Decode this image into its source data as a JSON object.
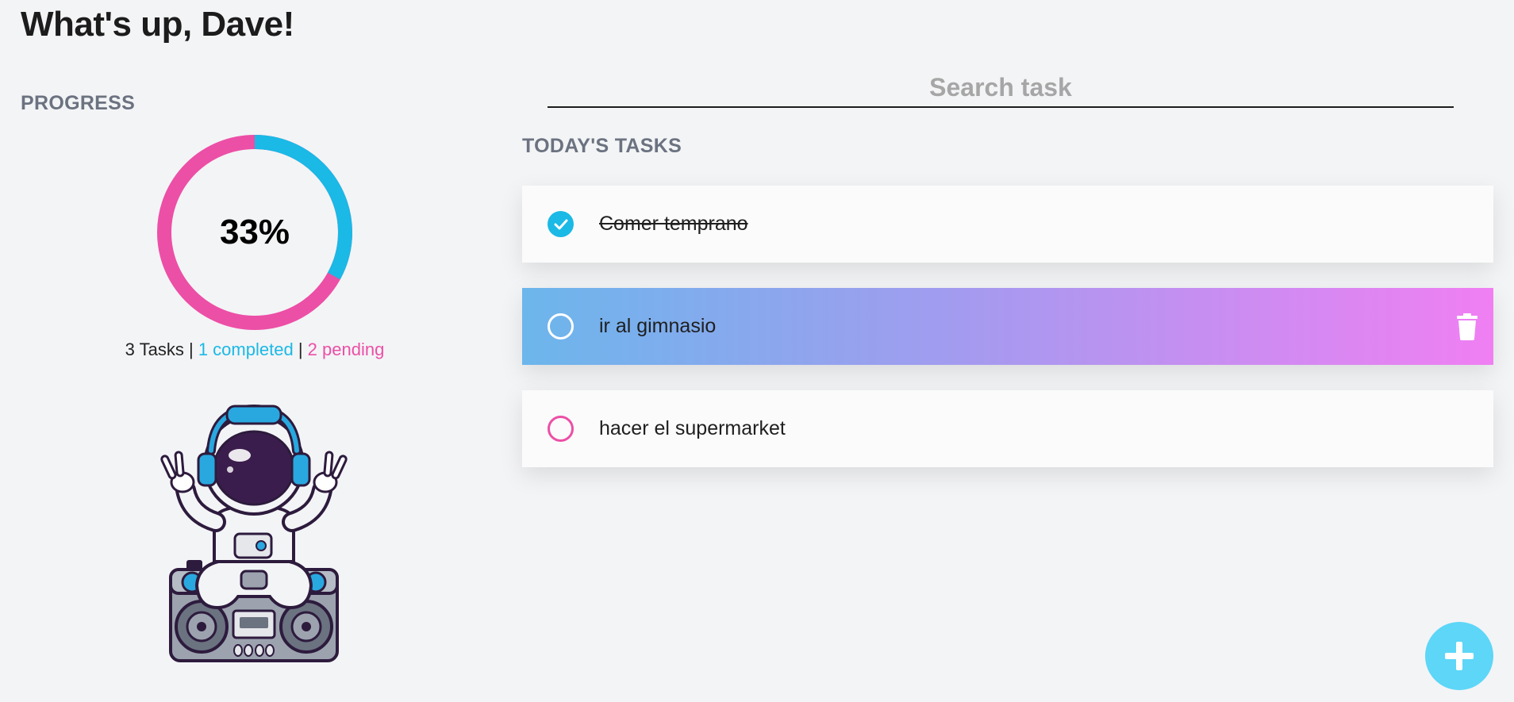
{
  "header": {
    "greeting": "What's up, Dave!"
  },
  "progress": {
    "title": "PROGRESS",
    "percent_label": "33%",
    "completed_fraction": 0.33,
    "colors": {
      "completed": "#1ab9e6",
      "pending": "#ec4fa6"
    },
    "total_label": "3 Tasks",
    "separator": "|",
    "completed_label": "1 completed",
    "pending_label": "2 pending"
  },
  "mascot": {
    "icon": "astronaut-dj-illustration"
  },
  "search": {
    "placeholder": "Search task",
    "value": ""
  },
  "tasks_section": {
    "title": "TODAY'S TASKS"
  },
  "tasks": [
    {
      "text": "Comer temprano",
      "completed": true
    },
    {
      "text": "ir al gimnasio",
      "completed": false,
      "hovered": true
    },
    {
      "text": "hacer el supermarket",
      "completed": false
    }
  ],
  "actions": {
    "delete_icon": "trash-icon",
    "add_icon": "plus-icon"
  }
}
